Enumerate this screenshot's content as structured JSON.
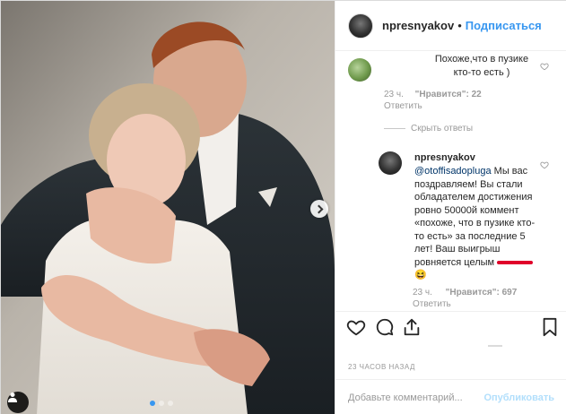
{
  "header": {
    "username": "npresnyakov",
    "separator": "•",
    "follow_label": "Подписаться"
  },
  "comments": {
    "first": {
      "text": "Похоже,что в пузике кто-то есть )",
      "time": "23 ч.",
      "likes": "\"Нравится\": 22",
      "reply_label": "Ответить"
    },
    "hide_replies_label": "Скрыть ответы",
    "reply": {
      "username": "npresnyakov",
      "mention": "@otoffisadopluga",
      "text": " Мы вас поздравляем! Вы стали обладателем достижения ровно 50000й коммент «похоже, что в пузике кто-то есть» за последние 5 лет! Ваш выигрыш ровняется целым",
      "emoji": "😆",
      "time": "23 ч.",
      "likes": "\"Нравится\": 697",
      "reply_label": "Ответить"
    }
  },
  "post": {
    "time_ago": "23 ЧАСОВ НАЗАД",
    "carousel_dots": 3,
    "active_dot": 1
  },
  "add_comment": {
    "placeholder": "Добавьте комментарий...",
    "publish_label": "Опубликовать"
  },
  "colors": {
    "accent": "#3897f0",
    "publish_disabled": "#b2dffc",
    "redaction": "#e0002a"
  },
  "icons": [
    "heart-icon",
    "comment-icon",
    "share-icon",
    "bookmark-icon",
    "tag-user-icon",
    "chevron-right-icon"
  ]
}
